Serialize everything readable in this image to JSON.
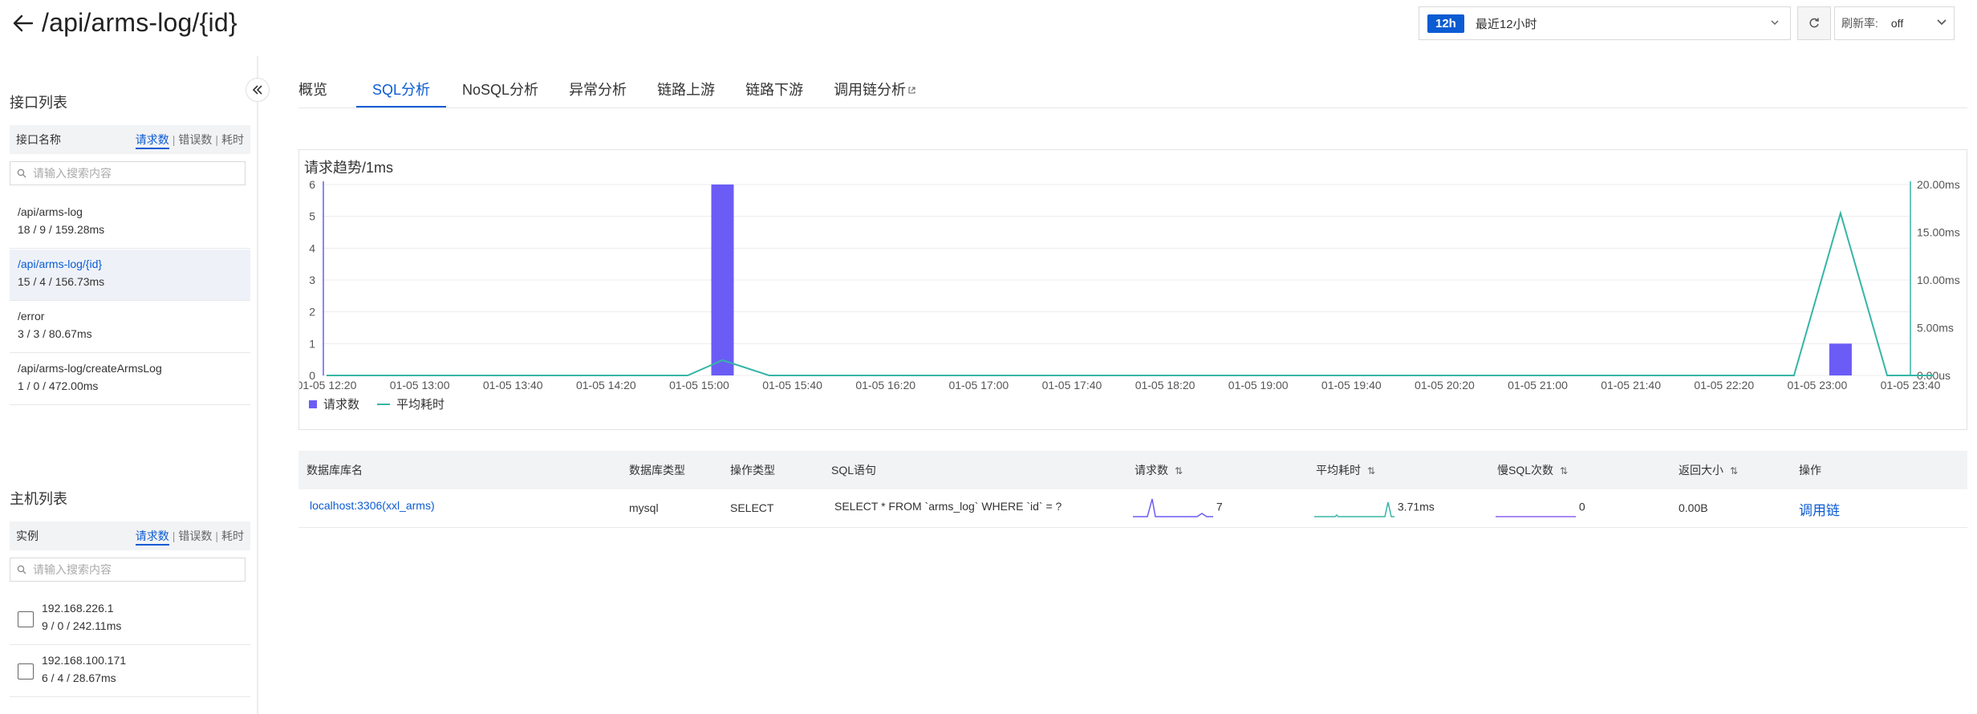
{
  "header": {
    "title": "/api/arms-log/{id}",
    "time_badge": "12h",
    "time_label": "最近12小时",
    "refresh_rate_label": "刷新率:",
    "refresh_rate_value": "off"
  },
  "sidebar": {
    "api_section_title": "接口列表",
    "api_list_header": "接口名称",
    "host_section_title": "主机列表",
    "host_list_header": "实例",
    "metric_tabs": [
      "请求数",
      "错误数",
      "耗时"
    ],
    "search_placeholder": "请输入搜索内容",
    "api_items": [
      {
        "name": "/api/arms-log",
        "stats": "18 / 9 / 159.28ms",
        "selected": false
      },
      {
        "name": "/api/arms-log/{id}",
        "stats": "15 / 4 / 156.73ms",
        "selected": true
      },
      {
        "name": "/error",
        "stats": "3 / 3 / 80.67ms",
        "selected": false
      },
      {
        "name": "/api/arms-log/createArmsLog",
        "stats": "1 / 0 / 472.00ms",
        "selected": false
      }
    ],
    "host_items": [
      {
        "ip": "192.168.226.1",
        "stats": "9 / 0 / 242.11ms"
      },
      {
        "ip": "192.168.100.171",
        "stats": "6 / 4 / 28.67ms"
      }
    ]
  },
  "tabs": [
    {
      "label": "概览",
      "active": false
    },
    {
      "label": "SQL分析",
      "active": true
    },
    {
      "label": "NoSQL分析",
      "active": false
    },
    {
      "label": "异常分析",
      "active": false
    },
    {
      "label": "链路上游",
      "active": false
    },
    {
      "label": "链路下游",
      "active": false
    },
    {
      "label": "调用链分析",
      "active": false,
      "external": true
    }
  ],
  "chart_data": {
    "type": "bar",
    "title": "请求趋势/1ms",
    "x_ticks": [
      "01-05 12:20",
      "01-05 13:00",
      "01-05 13:40",
      "01-05 14:20",
      "01-05 15:00",
      "01-05 15:40",
      "01-05 16:20",
      "01-05 17:00",
      "01-05 17:40",
      "01-05 18:20",
      "01-05 19:00",
      "01-05 19:40",
      "01-05 20:20",
      "01-05 21:00",
      "01-05 21:40",
      "01-05 22:20",
      "01-05 23:00",
      "01-05 23:40"
    ],
    "y_left_ticks": [
      "0",
      "1",
      "2",
      "3",
      "4",
      "5",
      "6"
    ],
    "y_right_ticks": [
      "0.00us",
      "5.00ms",
      "10.00ms",
      "15.00ms",
      "20.00ms"
    ],
    "ylim_left": [
      0,
      6
    ],
    "ylim_right_ms": [
      0,
      20
    ],
    "series": [
      {
        "name": "请求数",
        "kind": "bar",
        "color": "#6b5cf6",
        "points": [
          {
            "x": "01-05 15:10",
            "y": 6
          },
          {
            "x": "01-05 23:10",
            "y": 1
          }
        ]
      },
      {
        "name": "平均耗时",
        "kind": "line",
        "color": "#36b5a6",
        "unit": "ms",
        "points": [
          {
            "x": "01-05 12:20",
            "y": 0
          },
          {
            "x": "01-05 14:55",
            "y": 0
          },
          {
            "x": "01-05 15:10",
            "y": 1.6
          },
          {
            "x": "01-05 15:30",
            "y": 0
          },
          {
            "x": "01-05 22:50",
            "y": 0
          },
          {
            "x": "01-05 23:10",
            "y": 17
          },
          {
            "x": "01-05 23:30",
            "y": 0
          },
          {
            "x": "01-05 23:50",
            "y": 0
          }
        ]
      }
    ],
    "legend": [
      "请求数",
      "平均耗时"
    ],
    "legend_position": "bottom-left"
  },
  "table": {
    "columns": [
      "数据库库名",
      "数据库类型",
      "操作类型",
      "SQL语句",
      "请求数",
      "平均耗时",
      "慢SQL次数",
      "返回大小",
      "操作"
    ],
    "rows": [
      {
        "db_name": "localhost:3306(xxl_arms)",
        "db_type": "mysql",
        "op_type": "SELECT",
        "sql": "SELECT * FROM `arms_log` WHERE `id` = ?",
        "requests": "7",
        "avg_time": "3.71ms",
        "slow_count": "0",
        "return_size": "0.00B",
        "action": "调用链"
      }
    ]
  },
  "colors": {
    "accent": "#0b5bd3",
    "bar": "#6b5cf6",
    "line": "#36b5a6"
  }
}
